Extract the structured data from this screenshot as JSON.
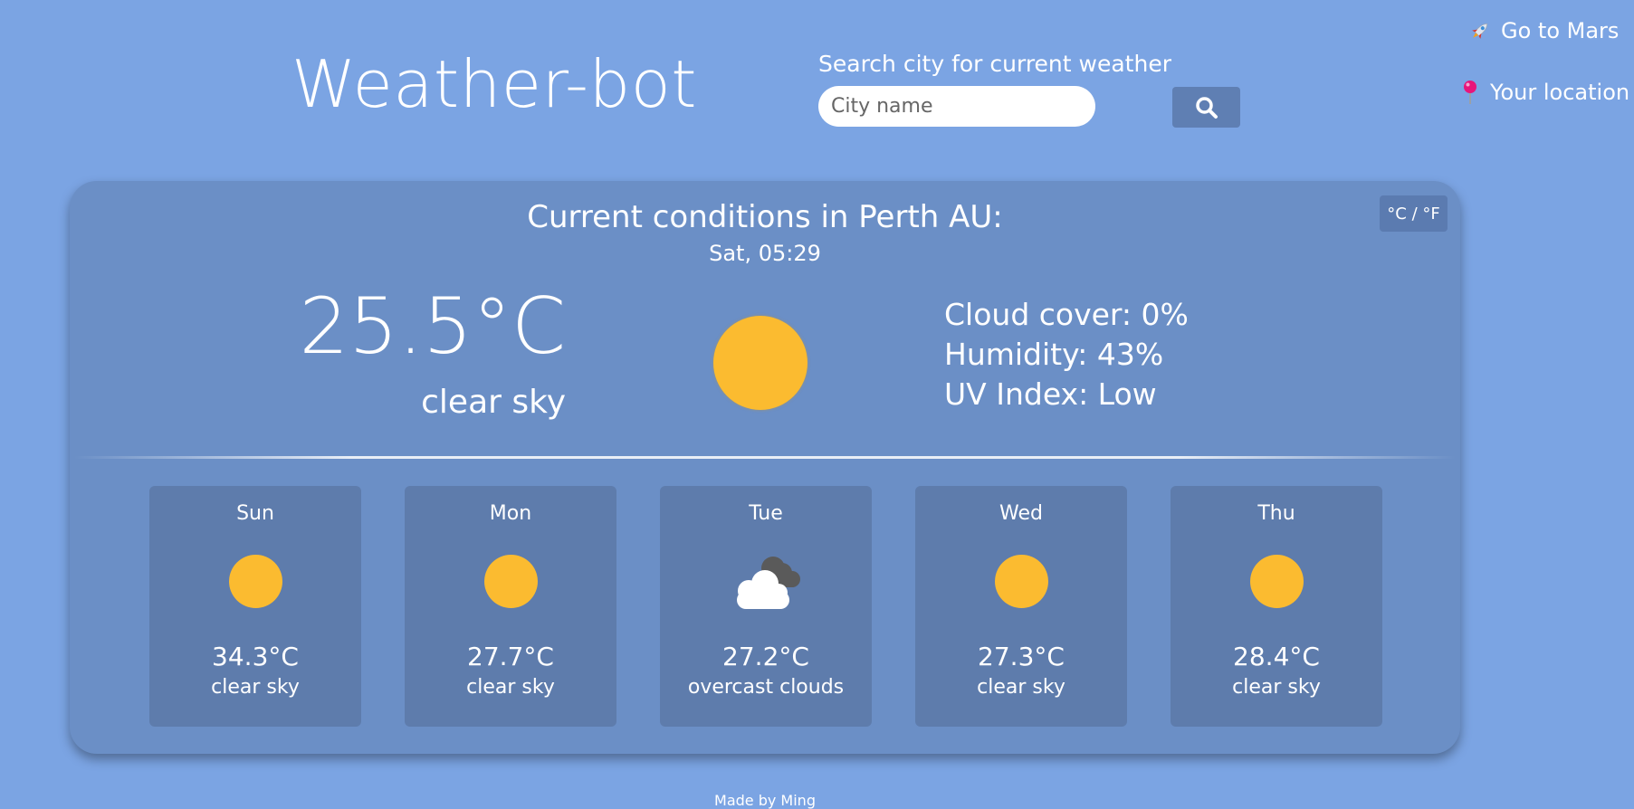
{
  "header": {
    "title": "Weather-bot",
    "search_label": "Search city for current weather",
    "search_placeholder": "City name",
    "search_icon": "search-icon"
  },
  "nav": {
    "mars_label": "Go to Mars",
    "mars_icon": "rocket-icon",
    "location_label": "Your location",
    "location_icon": "pushpin-icon"
  },
  "current": {
    "unit_toggle": "°C / °F",
    "title": "Current conditions in Perth AU:",
    "time": "Sat, 05:29",
    "temperature": "25.5°C",
    "description": "clear sky",
    "icon": "sun-icon",
    "cloud_cover": "Cloud cover: 0%",
    "humidity": "Humidity: 43%",
    "uv_index": "UV Index: Low"
  },
  "forecast": [
    {
      "day": "Sun",
      "temp": "34.3°C",
      "desc": "clear sky",
      "icon": "sun-icon"
    },
    {
      "day": "Mon",
      "temp": "27.7°C",
      "desc": "clear sky",
      "icon": "sun-icon"
    },
    {
      "day": "Tue",
      "temp": "27.2°C",
      "desc": "overcast clouds",
      "icon": "overcast-cloud-icon"
    },
    {
      "day": "Wed",
      "temp": "27.3°C",
      "desc": "clear sky",
      "icon": "sun-icon"
    },
    {
      "day": "Thu",
      "temp": "28.4°C",
      "desc": "clear sky",
      "icon": "sun-icon"
    }
  ],
  "footer": {
    "text": "Made by Ming"
  },
  "colors": {
    "background": "#7ba4e3",
    "card": "#6b8fc6",
    "forecast_card": "#5e7cac",
    "sun": "#fbbb30",
    "location_pin": "#e8157a"
  }
}
